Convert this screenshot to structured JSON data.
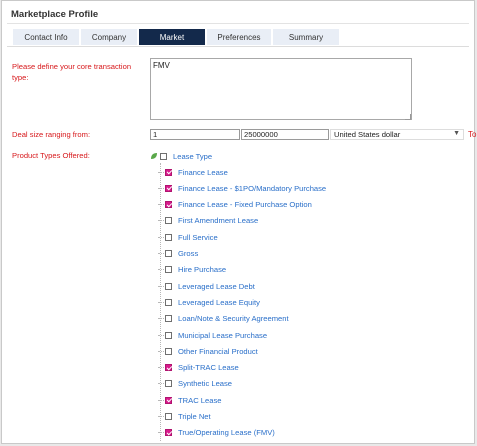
{
  "panel": {
    "title": "Marketplace Profile"
  },
  "tabs": [
    {
      "label": "Contact Info",
      "active": false
    },
    {
      "label": "Company",
      "active": false
    },
    {
      "label": "Market",
      "active": true
    },
    {
      "label": "Preferences",
      "active": false
    },
    {
      "label": "Summary",
      "active": false
    }
  ],
  "core": {
    "label": "Please define your core transaction type:",
    "value": "FMV"
  },
  "deal": {
    "label": "Deal size ranging from:",
    "min": "1",
    "max": "25000000",
    "currency": "United States dollar",
    "to": "To"
  },
  "products": {
    "label": "Product Types Offered:",
    "root": "Lease Type",
    "items": [
      {
        "label": "Finance Lease",
        "checked": true
      },
      {
        "label": "Finance Lease - $1PO/Mandatory Purchase",
        "checked": true
      },
      {
        "label": "Finance Lease - Fixed Purchase Option",
        "checked": true
      },
      {
        "label": "First Amendment Lease",
        "checked": false
      },
      {
        "label": "Full Service",
        "checked": false
      },
      {
        "label": "Gross",
        "checked": false
      },
      {
        "label": "Hire Purchase",
        "checked": false
      },
      {
        "label": "Leveraged Lease Debt",
        "checked": false
      },
      {
        "label": "Leveraged Lease Equity",
        "checked": false
      },
      {
        "label": "Loan/Note & Security Agreement",
        "checked": false
      },
      {
        "label": "Municipal Lease Purchase",
        "checked": false
      },
      {
        "label": "Other Financial Product",
        "checked": false
      },
      {
        "label": "Split-TRAC Lease",
        "checked": true
      },
      {
        "label": "Synthetic Lease",
        "checked": false
      },
      {
        "label": "TRAC Lease",
        "checked": true
      },
      {
        "label": "Triple Net",
        "checked": false
      },
      {
        "label": "True/Operating Lease (FMV)",
        "checked": true
      }
    ]
  },
  "colors": {
    "tab_active": "#13294b",
    "label_red": "#d7191c",
    "link_blue": "#2a6fc9",
    "check_pink": "#d81b8c"
  }
}
